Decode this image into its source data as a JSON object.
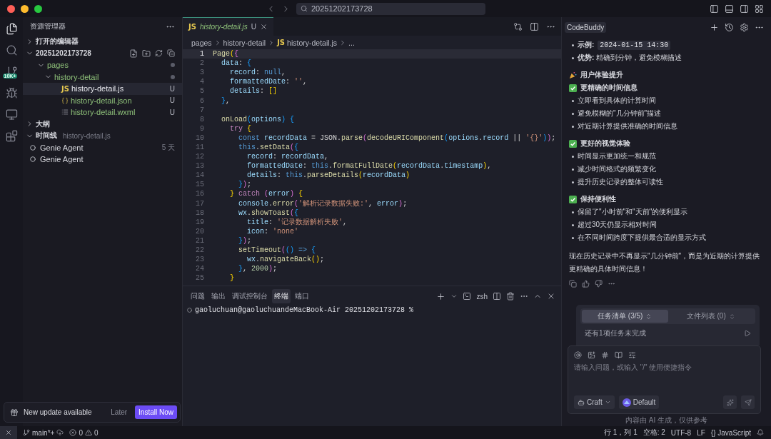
{
  "window": {
    "search": "20251202173728"
  },
  "activity_bar": {
    "items": [
      {
        "selected": true
      },
      {
        "selected": false
      },
      {
        "selected": false,
        "badge": "10K+"
      },
      {
        "selected": false
      },
      {
        "selected": false
      },
      {
        "selected": false
      }
    ]
  },
  "explorer": {
    "title": "资源管理器",
    "sections": [
      {
        "kind": "editors",
        "label": "打开的编辑器",
        "expanded": false
      },
      {
        "kind": "project",
        "label": "20251202173728",
        "expanded": true,
        "children": [
          {
            "kind": "folder",
            "label": "pages",
            "expanded": true,
            "modified": true,
            "children": [
              {
                "kind": "folder",
                "label": "history-detail",
                "expanded": true,
                "modified": true,
                "children": [
                  {
                    "kind": "js",
                    "icon_text": "JS",
                    "label": "history-detail.js",
                    "status": "U",
                    "selected": true
                  },
                  {
                    "kind": "json",
                    "label": "history-detail.json",
                    "status": "U",
                    "selected": false
                  },
                  {
                    "kind": "wxml",
                    "label": "history-detail.wxml",
                    "status": "U",
                    "selected": false
                  }
                ]
              }
            ]
          }
        ]
      },
      {
        "kind": "outline",
        "label": "大纲",
        "expanded": false
      },
      {
        "kind": "timeline",
        "label": "时间线",
        "expanded": true,
        "subtitle": "history-detail.js",
        "items": [
          {
            "label": "Genie Agent",
            "time": "5 天"
          },
          {
            "label": "Genie Agent"
          }
        ]
      }
    ]
  },
  "notification": {
    "text": "New update available",
    "buttons": [
      "Later",
      "Install Now"
    ]
  },
  "editor": {
    "tab": {
      "icon_text": "JS",
      "label": "history-detail.js",
      "status": "U",
      "selected": true
    },
    "breadcrumb": [
      {
        "label": "pages"
      },
      {
        "label": "history-detail"
      },
      {
        "icon_text": "JS",
        "label": "history-detail.js"
      },
      {
        "label": "..."
      }
    ],
    "lines": [
      {
        "number": "1",
        "current": true,
        "tokens": [
          {
            "kind": "func",
            "text": "Page"
          },
          {
            "kind": "b1",
            "text": "("
          },
          {
            "kind": "b2",
            "text": "{"
          }
        ]
      },
      {
        "number": "2",
        "current": false,
        "tokens": [
          {
            "kind": "prop",
            "text": "  data"
          },
          {
            "kind": "plain",
            "text": ": "
          },
          {
            "kind": "b3",
            "text": "{"
          }
        ]
      },
      {
        "number": "3",
        "current": false,
        "tokens": [
          {
            "kind": "prop",
            "text": "    record"
          },
          {
            "kind": "plain",
            "text": ": "
          },
          {
            "kind": "storage",
            "text": "null"
          },
          {
            "kind": "plain",
            "text": ","
          }
        ]
      },
      {
        "number": "4",
        "current": false,
        "tokens": [
          {
            "kind": "prop",
            "text": "    formattedDate"
          },
          {
            "kind": "plain",
            "text": ": "
          },
          {
            "kind": "str",
            "text": "''"
          },
          {
            "kind": "plain",
            "text": ","
          }
        ]
      },
      {
        "number": "5",
        "current": false,
        "tokens": [
          {
            "kind": "prop",
            "text": "    details"
          },
          {
            "kind": "plain",
            "text": ": "
          },
          {
            "kind": "b1",
            "text": "[]"
          }
        ]
      },
      {
        "number": "6",
        "current": false,
        "tokens": [
          {
            "kind": "b3",
            "text": "  }"
          },
          {
            "kind": "plain",
            "text": ","
          }
        ]
      },
      {
        "number": "7",
        "current": false
      },
      {
        "number": "8",
        "current": false,
        "tokens": [
          {
            "kind": "func",
            "text": "  onLoad"
          },
          {
            "kind": "b3",
            "text": "("
          },
          {
            "kind": "var",
            "text": "options"
          },
          {
            "kind": "b3",
            "text": ") {"
          }
        ]
      },
      {
        "number": "9",
        "current": false,
        "tokens": [
          {
            "kind": "kw",
            "text": "    try "
          },
          {
            "kind": "b1",
            "text": "{"
          }
        ]
      },
      {
        "number": "10",
        "current": false,
        "tokens": [
          {
            "kind": "storage",
            "text": "      const "
          },
          {
            "kind": "var",
            "text": "recordData"
          },
          {
            "kind": "plain",
            "text": " = JSON."
          },
          {
            "kind": "func",
            "text": "parse"
          },
          {
            "kind": "b2",
            "text": "("
          },
          {
            "kind": "func",
            "text": "decodeURIComponent"
          },
          {
            "kind": "b3",
            "text": "("
          },
          {
            "kind": "var",
            "text": "options"
          },
          {
            "kind": "plain",
            "text": "."
          },
          {
            "kind": "var",
            "text": "record"
          },
          {
            "kind": "plain",
            "text": " || "
          },
          {
            "kind": "str",
            "text": "'{}'"
          },
          {
            "kind": "b3",
            "text": ")"
          },
          {
            "kind": "b2",
            "text": ")"
          },
          {
            "kind": "plain",
            "text": ";"
          }
        ]
      },
      {
        "number": "11",
        "current": false,
        "tokens": [
          {
            "kind": "storage",
            "text": "      this"
          },
          {
            "kind": "plain",
            "text": "."
          },
          {
            "kind": "func",
            "text": "setData"
          },
          {
            "kind": "b2",
            "text": "("
          },
          {
            "kind": "b3",
            "text": "{"
          }
        ]
      },
      {
        "number": "12",
        "current": false,
        "tokens": [
          {
            "kind": "prop",
            "text": "        record"
          },
          {
            "kind": "plain",
            "text": ": "
          },
          {
            "kind": "var",
            "text": "recordData"
          },
          {
            "kind": "plain",
            "text": ","
          }
        ]
      },
      {
        "number": "13",
        "current": false,
        "tokens": [
          {
            "kind": "prop",
            "text": "        formattedDate"
          },
          {
            "kind": "plain",
            "text": ": "
          },
          {
            "kind": "storage",
            "text": "this"
          },
          {
            "kind": "plain",
            "text": "."
          },
          {
            "kind": "func",
            "text": "formatFullDate"
          },
          {
            "kind": "b1",
            "text": "("
          },
          {
            "kind": "var",
            "text": "recordData"
          },
          {
            "kind": "plain",
            "text": "."
          },
          {
            "kind": "var",
            "text": "timestamp"
          },
          {
            "kind": "b1",
            "text": ")"
          },
          {
            "kind": "plain",
            "text": ","
          }
        ]
      },
      {
        "number": "14",
        "current": false,
        "tokens": [
          {
            "kind": "prop",
            "text": "        details"
          },
          {
            "kind": "plain",
            "text": ": "
          },
          {
            "kind": "storage",
            "text": "this"
          },
          {
            "kind": "plain",
            "text": "."
          },
          {
            "kind": "func",
            "text": "parseDetails"
          },
          {
            "kind": "b1",
            "text": "("
          },
          {
            "kind": "var",
            "text": "recordData"
          },
          {
            "kind": "b1",
            "text": ")"
          }
        ]
      },
      {
        "number": "15",
        "current": false,
        "tokens": [
          {
            "kind": "b3",
            "text": "      }"
          },
          {
            "kind": "b2",
            "text": ")"
          },
          {
            "kind": "plain",
            "text": ";"
          }
        ]
      },
      {
        "number": "16",
        "current": false,
        "tokens": [
          {
            "kind": "b1",
            "text": "    } "
          },
          {
            "kind": "kw",
            "text": "catch "
          },
          {
            "kind": "b2",
            "text": "("
          },
          {
            "kind": "var",
            "text": "error"
          },
          {
            "kind": "b2",
            "text": ")"
          },
          {
            "kind": "b1",
            "text": " {"
          }
        ]
      },
      {
        "number": "17",
        "current": false,
        "tokens": [
          {
            "kind": "var",
            "text": "      console"
          },
          {
            "kind": "plain",
            "text": "."
          },
          {
            "kind": "func",
            "text": "error"
          },
          {
            "kind": "b2",
            "text": "("
          },
          {
            "kind": "str",
            "text": "'解析记录数据失败:'"
          },
          {
            "kind": "plain",
            "text": ", "
          },
          {
            "kind": "var",
            "text": "error"
          },
          {
            "kind": "b2",
            "text": ")"
          },
          {
            "kind": "plain",
            "text": ";"
          }
        ]
      },
      {
        "number": "18",
        "current": false,
        "tokens": [
          {
            "kind": "var",
            "text": "      wx"
          },
          {
            "kind": "plain",
            "text": "."
          },
          {
            "kind": "func",
            "text": "showToast"
          },
          {
            "kind": "b2",
            "text": "("
          },
          {
            "kind": "b3",
            "text": "{"
          }
        ]
      },
      {
        "number": "19",
        "current": false,
        "tokens": [
          {
            "kind": "prop",
            "text": "        title"
          },
          {
            "kind": "plain",
            "text": ": "
          },
          {
            "kind": "str",
            "text": "'记录数据解析失败'"
          },
          {
            "kind": "plain",
            "text": ","
          }
        ]
      },
      {
        "number": "20",
        "current": false,
        "tokens": [
          {
            "kind": "prop",
            "text": "        icon"
          },
          {
            "kind": "plain",
            "text": ": "
          },
          {
            "kind": "str",
            "text": "'none'"
          }
        ]
      },
      {
        "number": "21",
        "current": false,
        "tokens": [
          {
            "kind": "b3",
            "text": "      }"
          },
          {
            "kind": "b2",
            "text": ")"
          },
          {
            "kind": "plain",
            "text": ";"
          }
        ]
      },
      {
        "number": "22",
        "current": false,
        "tokens": [
          {
            "kind": "func",
            "text": "      setTimeout"
          },
          {
            "kind": "b2",
            "text": "("
          },
          {
            "kind": "b3",
            "text": "() "
          },
          {
            "kind": "storage",
            "text": "=>"
          },
          {
            "kind": "b3",
            "text": " {"
          }
        ]
      },
      {
        "number": "23",
        "current": false,
        "tokens": [
          {
            "kind": "var",
            "text": "        wx"
          },
          {
            "kind": "plain",
            "text": "."
          },
          {
            "kind": "func",
            "text": "navigateBack"
          },
          {
            "kind": "b1",
            "text": "()"
          },
          {
            "kind": "plain",
            "text": ";"
          }
        ]
      },
      {
        "number": "24",
        "current": false,
        "tokens": [
          {
            "kind": "b3",
            "text": "      }"
          },
          {
            "kind": "plain",
            "text": ", "
          },
          {
            "kind": "num",
            "text": "2000"
          },
          {
            "kind": "b2",
            "text": ")"
          },
          {
            "kind": "plain",
            "text": ";"
          }
        ]
      },
      {
        "number": "25",
        "current": false,
        "tokens": [
          {
            "kind": "b1",
            "text": "    }"
          }
        ]
      }
    ]
  },
  "panel": {
    "tabs": [
      {
        "label": "问题",
        "selected": false
      },
      {
        "label": "输出",
        "selected": false
      },
      {
        "label": "调试控制台",
        "selected": false
      },
      {
        "label": "终端",
        "selected": true
      },
      {
        "label": "端口",
        "selected": false
      }
    ],
    "shell": "zsh",
    "prompt": "gaoluchuan@gaoluchuandeMacBook-Air 20251202173728 %"
  },
  "assistant": {
    "title": "CodeBuddy",
    "messages": [
      {
        "kind": "bullet",
        "text": "**示例:**",
        "code": "2024-01-15 14:30"
      },
      {
        "kind": "bullet",
        "text": "**优势:** 精确到分钟，避免模糊描述"
      },
      {
        "kind": "party-heading",
        "text": "用户体验提升"
      },
      {
        "kind": "check-heading",
        "text": "更精确的时间信息"
      },
      {
        "kind": "bullet",
        "text": "立即看到具体的计算时间"
      },
      {
        "kind": "bullet",
        "text": "避免模糊的\"几分钟前\"描述"
      },
      {
        "kind": "bullet",
        "text": "对近期计算提供准确的时间信息"
      },
      {
        "kind": "check-heading",
        "text": "更好的视觉体验"
      },
      {
        "kind": "bullet",
        "text": "时间显示更加统一和规范"
      },
      {
        "kind": "bullet",
        "text": "减少时间格式的频繁变化"
      },
      {
        "kind": "bullet",
        "text": "提升历史记录的整体可读性"
      },
      {
        "kind": "check-heading",
        "text": "保持便利性"
      },
      {
        "kind": "bullet",
        "text": "保留了\"小时前\"和\"天前\"的便利显示"
      },
      {
        "kind": "bullet",
        "text": "超过30天仍显示相对时间"
      },
      {
        "kind": "bullet",
        "text": "在不同时间跨度下提供最合适的显示方式"
      },
      {
        "kind": "paragraph",
        "text": "现在历史记录中不再显示\"几分钟前\"，而是为近期的计算提供更精确的具体时间信息！"
      }
    ],
    "task_tabs": [
      {
        "label": "任务清单 (3/5)",
        "selected": true
      },
      {
        "label": "文件列表 (0)",
        "selected": false
      }
    ],
    "task_status": "还有1项任务未完成",
    "input": {
      "placeholder": "请输入问题，或输入 \"/\" 使用便捷指令"
    },
    "mode": "Craft",
    "model": "Default",
    "disclaimer": "内容由 AI 生成，仅供参考"
  },
  "status_bar": {
    "branch": "main*+",
    "errors": "0",
    "warnings": "0",
    "items": [
      "行 1，列 1",
      "空格: 2",
      "UTF-8",
      "LF",
      "{} JavaScript"
    ]
  }
}
